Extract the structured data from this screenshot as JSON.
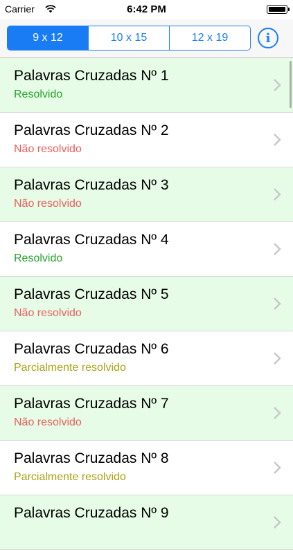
{
  "status_bar": {
    "carrier": "Carrier",
    "time": "6:42 PM"
  },
  "segments": [
    {
      "label": "9 x 12",
      "selected": true
    },
    {
      "label": "10 x 15",
      "selected": false
    },
    {
      "label": "12 x 19",
      "selected": false
    }
  ],
  "info_button": {
    "icon": "info-icon",
    "glyph": "i"
  },
  "colors": {
    "accent": "#1a7cf5",
    "row_tint": "#e6fce6",
    "solved": "#22a327",
    "unsolved": "#ec5d5d",
    "partial": "#a9a213"
  },
  "puzzles": [
    {
      "title": "Palavras Cruzadas Nº 1",
      "status": "Resolvido",
      "state": "solved"
    },
    {
      "title": "Palavras Cruzadas Nº 2",
      "status": "Não resolvido",
      "state": "unsolved"
    },
    {
      "title": "Palavras Cruzadas Nº 3",
      "status": "Não resolvido",
      "state": "unsolved"
    },
    {
      "title": "Palavras Cruzadas Nº 4",
      "status": "Resolvido",
      "state": "solved"
    },
    {
      "title": "Palavras Cruzadas Nº 5",
      "status": "Não resolvido",
      "state": "unsolved"
    },
    {
      "title": "Palavras Cruzadas Nº 6",
      "status": "Parcialmente resolvido",
      "state": "partial"
    },
    {
      "title": "Palavras Cruzadas Nº 7",
      "status": "Não resolvido",
      "state": "unsolved"
    },
    {
      "title": "Palavras Cruzadas Nº 8",
      "status": "Parcialmente resolvido",
      "state": "partial"
    },
    {
      "title": "Palavras Cruzadas Nº 9",
      "status": "",
      "state": "unsolved"
    }
  ]
}
